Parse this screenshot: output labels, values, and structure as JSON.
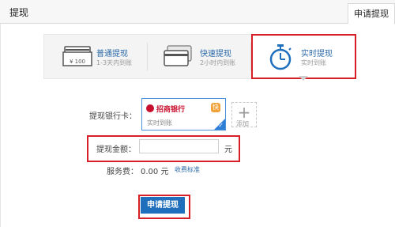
{
  "header": {
    "title": "提现",
    "tab": "申请提现"
  },
  "methods": [
    {
      "name": "普通提现",
      "desc": "1-3天内到账",
      "icon": "card-slot-icon",
      "icon_text": "¥ 100"
    },
    {
      "name": "快速提现",
      "desc": "2小时内到账",
      "icon": "card-icon"
    },
    {
      "name": "实时提现",
      "desc": "实时到账",
      "icon": "stopwatch-icon"
    }
  ],
  "form": {
    "bank_label": "提现银行卡：",
    "bank_card": {
      "name": "招商银行",
      "sub": "实时到账",
      "badge": "快"
    },
    "add_label": "添加",
    "amount_label": "提现金额：",
    "amount_value": "",
    "amount_unit": "元",
    "fee_label": "服务费：",
    "fee_value": "0.00 元",
    "fee_link": "收费标准"
  },
  "submit_label": "申请提现",
  "colors": {
    "highlight": "#d61f26",
    "primary": "#1f6fbd",
    "link": "#2b6aa8"
  }
}
